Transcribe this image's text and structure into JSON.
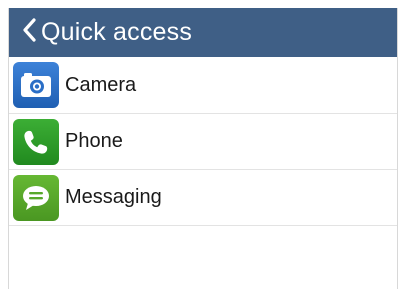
{
  "header": {
    "title": "Quick access",
    "back_icon": "chevron-left-icon",
    "background": "#3f5f86"
  },
  "items": [
    {
      "label": "Camera",
      "icon": "camera-icon",
      "color": "#2a6ec6"
    },
    {
      "label": "Phone",
      "icon": "phone-icon",
      "color": "#2e9a2a"
    },
    {
      "label": "Messaging",
      "icon": "message-icon",
      "color": "#58a82a"
    }
  ]
}
